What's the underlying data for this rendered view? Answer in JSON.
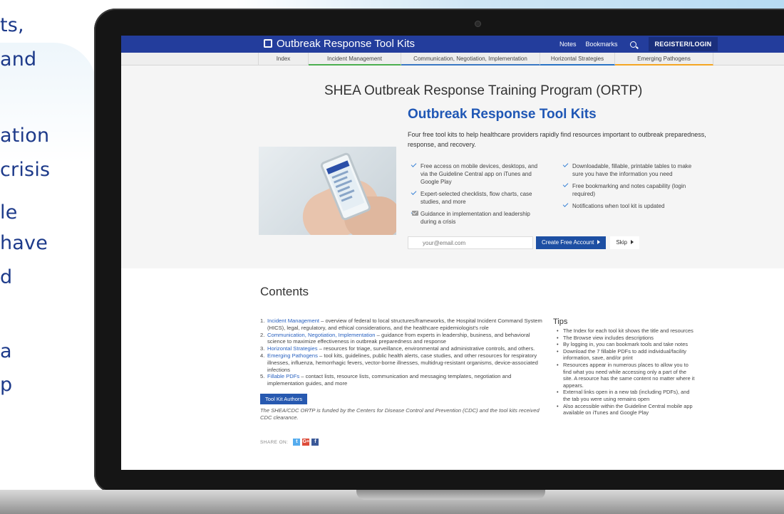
{
  "promo": {
    "lines": [
      "ts,",
      "and",
      "ation",
      "crisis",
      "le",
      "have",
      "d",
      "a",
      "p"
    ]
  },
  "header": {
    "title": "Outbreak Response Tool Kits",
    "notes": "Notes",
    "bookmarks": "Bookmarks",
    "login": "REGISTER/LOGIN"
  },
  "tabs": [
    {
      "label": "Index"
    },
    {
      "label": "Incident Management"
    },
    {
      "label": "Communication, Negotiation, Implementation"
    },
    {
      "label": "Horizontal Strategies"
    },
    {
      "label": "Emerging Pathogens"
    }
  ],
  "hero": {
    "program_title": "SHEA Outbreak Response Training Program (ORTP)",
    "kit_title": "Outbreak Response Tool Kits",
    "description": "Four free tool kits to help healthcare providers rapidly find resources important to outbreak preparedness, response, and recovery.",
    "features_left": [
      "Free access on mobile devices, desktops, and via the Guideline Central app on iTunes and Google Play",
      "Expert-selected checklists, flow charts, case studies, and more",
      "Guidance in implementation and leadership during a crisis"
    ],
    "features_right": [
      "Downloadable, fillable, printable tables to make sure you have the information you need",
      "Free bookmarking and notes capability (login required)",
      "Notifications when tool kit is updated"
    ],
    "email_placeholder": "your@email.com",
    "create_account": "Create Free Account",
    "skip": "Skip"
  },
  "contents": {
    "title": "Contents",
    "items": [
      {
        "num": "1.",
        "link": "Incident Management",
        "text": " – overview of federal to local structures/frameworks, the Hospital Incident Command System (HICS), legal, regulatory, and ethical considerations, and the healthcare epidemiologist's role"
      },
      {
        "num": "2.",
        "link": "Communication, Negotiation, Implementation",
        "text": " – guidance from experts in leadership, business, and behavioral science to maximize effectiveness in outbreak preparedness and response"
      },
      {
        "num": "3.",
        "link": "Horizontal Strategies",
        "text": " – resources for triage, surveillance, environmental and administrative controls, and others."
      },
      {
        "num": "4.",
        "link": "Emerging Pathogens",
        "text": " – tool kits, guidelines, public health alerts, case studies, and other resources for respiratory illnesses, influenza, hemorrhagic fevers, vector-borne illnesses, multidrug-resistant organisms, device-associated infections"
      },
      {
        "num": "5.",
        "link": "Fillable PDFs",
        "text": " – contact lists, resource lists, communication and messaging templates, negotiation and implementation guides, and more"
      }
    ],
    "authors_button": "Tool Kit Authors",
    "funded": "The SHEA/CDC ORTP is funded by the Centers for Disease Control and Prevention (CDC) and the tool kits received CDC clearance.",
    "share_label": "SHARE ON:",
    "social": [
      {
        "glyph": "t",
        "color": "#55acee"
      },
      {
        "glyph": "G+",
        "color": "#dd4b39"
      },
      {
        "glyph": "f",
        "color": "#3b5998"
      }
    ]
  },
  "tips": {
    "title": "Tips",
    "items": [
      "The Index for each tool kit shows the title and resources",
      "The Browse view includes descriptions",
      "By logging in, you can bookmark tools and take notes",
      "Download the 7 fillable PDFs to add individual/facility information, save, and/or print",
      "Resources appear in numerous places to allow you to find what you need while accessing only a part of the site. A resource has the same content no matter where it appears.",
      "External links open in a new tab (including PDFs), and the tab you were using remains open",
      "Also accessible within the Guideline Central mobile app available on iTunes and Google Play"
    ]
  }
}
